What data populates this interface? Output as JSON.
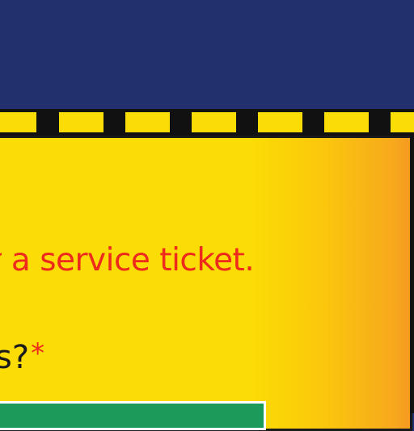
{
  "colors": {
    "header": "#22306e",
    "panel_start": "#fbdc04",
    "panel_end": "#f59a20",
    "notice_text": "#ee2a1c",
    "answer_box": "#1c9a5a"
  },
  "form": {
    "notice": "a service ticket.",
    "question": "s?",
    "required_marker": "*"
  }
}
